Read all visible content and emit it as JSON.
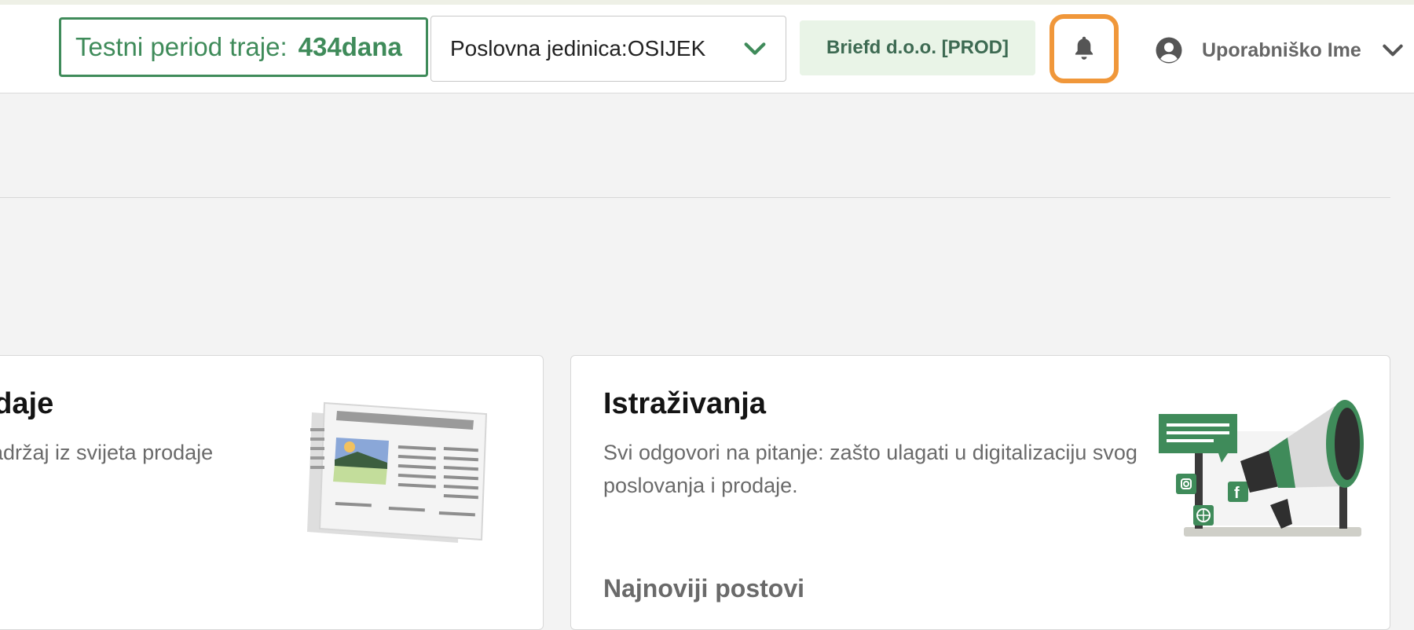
{
  "header": {
    "trial_label": "Testni period traje:",
    "trial_days": "434dana",
    "unit_value": "Poslovna jedinica:OSIJEK",
    "company": "Briefd d.o.o. [PROD]",
    "user_name": "Uporabniško Ime"
  },
  "cards": {
    "left": {
      "title": "odaje",
      "desc": "adržaj iz svijeta prodaje"
    },
    "right": {
      "title": "Istraživanja",
      "desc": "Svi odgovori na pitanje: zašto ulagati u digitalizaciju svog poslovanja i prodaje.",
      "subheading": "Najnoviji postovi"
    }
  },
  "colors": {
    "accent_green": "#3f8b5a",
    "highlight_orange": "#f0973a",
    "company_bg": "#e9f4e7"
  },
  "icons": {
    "unit_dropdown": "chevron-down-icon",
    "notifications": "bell-icon",
    "user_avatar": "user-circle-icon",
    "user_menu": "chevron-down-icon"
  }
}
